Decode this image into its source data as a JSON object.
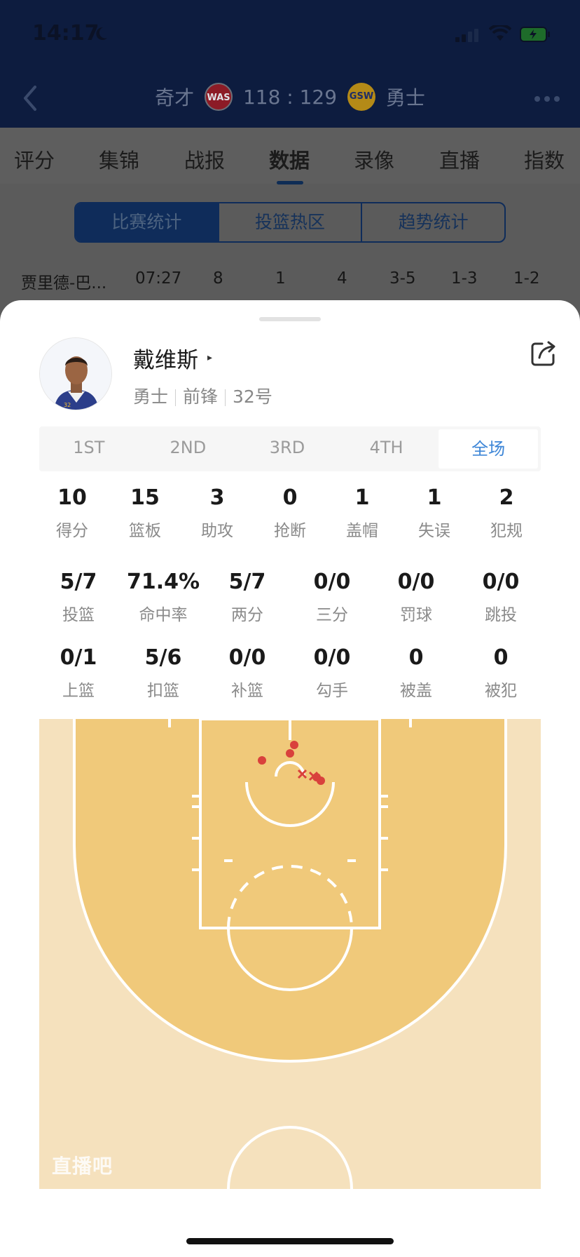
{
  "status": {
    "time": "14:17"
  },
  "header": {
    "away_team": "奇才",
    "away_logo": "WAS",
    "score": "118 : 129",
    "home_logo": "GSW",
    "home_team": "勇士"
  },
  "tabs": [
    "评分",
    "集锦",
    "战报",
    "数据",
    "录像",
    "直播",
    "指数"
  ],
  "active_tab": "数据",
  "segments": [
    "比赛统计",
    "投篮热区",
    "趋势统计"
  ],
  "active_segment": "比赛统计",
  "previous_row": [
    "贾里德-巴...",
    "07:27",
    "8",
    "1",
    "4",
    "3-5",
    "1-3",
    "1-2"
  ],
  "player": {
    "name": "戴维斯",
    "name_arrow": "▸",
    "team": "勇士",
    "position": "前锋",
    "number": "32号"
  },
  "quarters": [
    "1ST",
    "2ND",
    "3RD",
    "4TH",
    "全场"
  ],
  "active_quarter": "全场",
  "stats_row1": [
    {
      "value": "10",
      "label": "得分"
    },
    {
      "value": "15",
      "label": "篮板"
    },
    {
      "value": "3",
      "label": "助攻"
    },
    {
      "value": "0",
      "label": "抢断"
    },
    {
      "value": "1",
      "label": "盖帽"
    },
    {
      "value": "1",
      "label": "失误"
    },
    {
      "value": "2",
      "label": "犯规"
    }
  ],
  "stats_row2": [
    {
      "value": "5/7",
      "label": "投篮"
    },
    {
      "value": "71.4%",
      "label": "命中率"
    },
    {
      "value": "5/7",
      "label": "两分"
    },
    {
      "value": "0/0",
      "label": "三分"
    },
    {
      "value": "0/0",
      "label": "罚球"
    },
    {
      "value": "0/0",
      "label": "跳投"
    }
  ],
  "stats_row3": [
    {
      "value": "0/1",
      "label": "上篮"
    },
    {
      "value": "5/6",
      "label": "扣篮"
    },
    {
      "value": "0/0",
      "label": "补篮"
    },
    {
      "value": "0/0",
      "label": "勾手"
    },
    {
      "value": "0",
      "label": "被盖"
    },
    {
      "value": "0",
      "label": "被犯"
    }
  ],
  "shot_chart": {
    "made": 5,
    "missed": 2,
    "colors": {
      "paint_zone": "#f0c97a",
      "outer_zone": "#f5e1bd",
      "made": "#d9413c",
      "missed": "#d9413c"
    }
  },
  "watermark": "直播吧"
}
